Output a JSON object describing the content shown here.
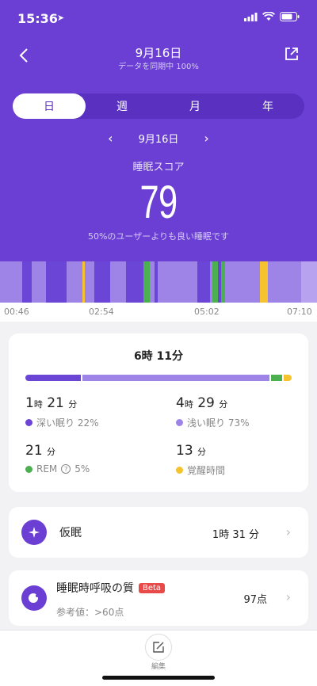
{
  "status": {
    "time": "15:36"
  },
  "nav": {
    "title": "9月16日",
    "subtitle": "データを同期中 100%"
  },
  "tabs": [
    {
      "label": "日",
      "active": true
    },
    {
      "label": "週",
      "active": false
    },
    {
      "label": "月",
      "active": false
    },
    {
      "label": "年",
      "active": false
    }
  ],
  "date": {
    "current": "9月16日"
  },
  "score": {
    "label": "睡眠スコア",
    "value": "79",
    "desc": "50%のユーザーよりも良い睡眠です"
  },
  "timeline": {
    "axis": [
      "00:46",
      "02:54",
      "05:02",
      "07:10"
    ],
    "segments": [
      {
        "stage": "light",
        "w": 28
      },
      {
        "stage": "deep",
        "w": 12
      },
      {
        "stage": "light",
        "w": 18
      },
      {
        "stage": "deep",
        "w": 26
      },
      {
        "stage": "light",
        "w": 20
      },
      {
        "stage": "awake",
        "w": 3
      },
      {
        "stage": "light",
        "w": 12
      },
      {
        "stage": "deep",
        "w": 20
      },
      {
        "stage": "light",
        "w": 20
      },
      {
        "stage": "deep",
        "w": 22
      },
      {
        "stage": "rem",
        "w": 8
      },
      {
        "stage": "light",
        "w": 6
      },
      {
        "stage": "deep",
        "w": 4
      },
      {
        "stage": "light",
        "w": 50
      },
      {
        "stage": "deep",
        "w": 16
      },
      {
        "stage": "light",
        "w": 3
      },
      {
        "stage": "rem",
        "w": 7
      },
      {
        "stage": "deep",
        "w": 4
      },
      {
        "stage": "rem",
        "w": 5
      },
      {
        "stage": "light",
        "w": 44
      },
      {
        "stage": "awake",
        "w": 10
      },
      {
        "stage": "light",
        "w": 42
      }
    ]
  },
  "summary": {
    "total": "6時 11分",
    "deep": {
      "h": "1",
      "hu": "時",
      "m": "21",
      "mu": "分",
      "label": "深い眠り 22%",
      "fraction": 0.22
    },
    "light": {
      "h": "4",
      "hu": "時",
      "m": "29",
      "mu": "分",
      "label": "浅い眠り 73%",
      "fraction": 0.73
    },
    "rem": {
      "m": "21",
      "mu": "分",
      "label": "REM",
      "pct": "5%",
      "fraction": 0.05
    },
    "awake": {
      "m": "13",
      "mu": "分",
      "label": "覚醒時間",
      "fraction": 0.03
    }
  },
  "nap": {
    "label": "仮眠",
    "duration": "1時 31 分"
  },
  "breath": {
    "label": "睡眠時呼吸の質",
    "badge": "Beta",
    "ref": "参考値：>60点",
    "score": "97点"
  },
  "bottom": {
    "edit_label": "編集"
  },
  "colors": {
    "deep": "#6a45d6",
    "light": "#9d84e6",
    "rem": "#4caf50",
    "awake": "#f5c330",
    "header": "#6b3fd3"
  }
}
